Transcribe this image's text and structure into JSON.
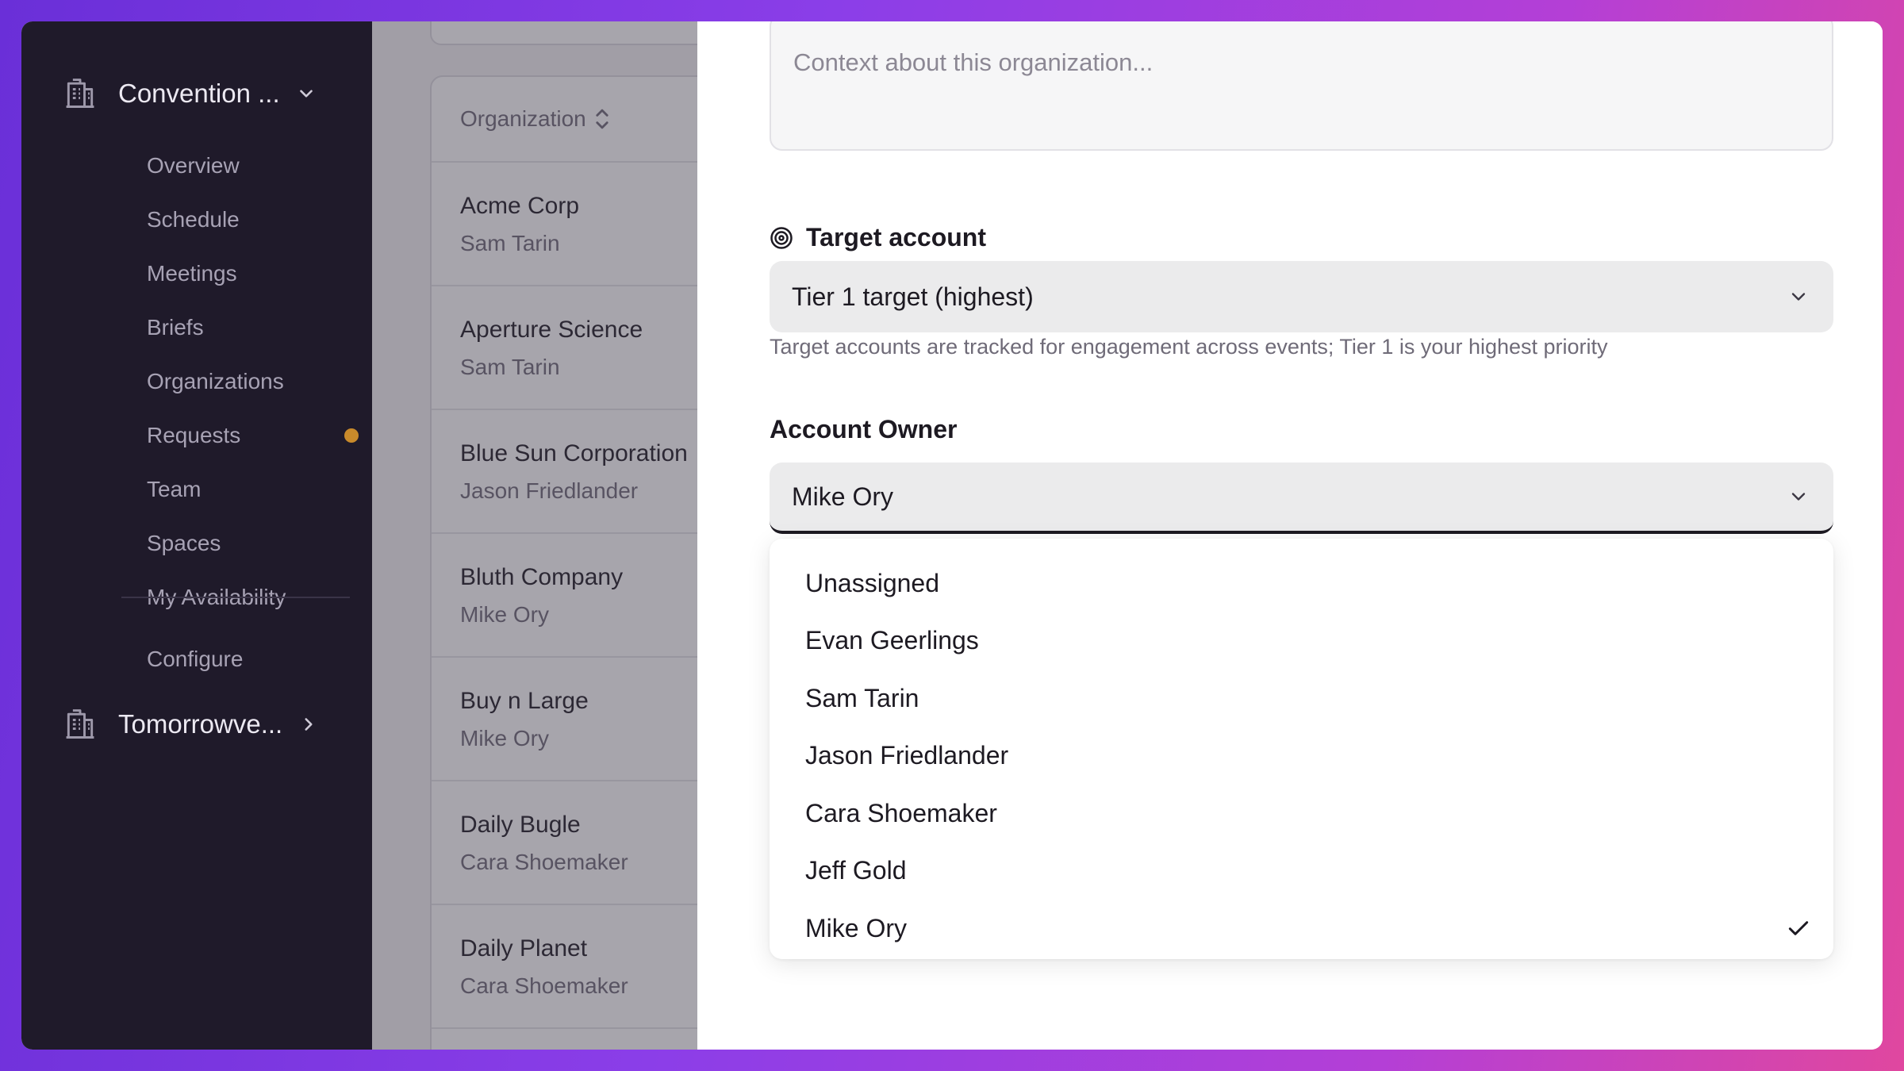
{
  "sidebar": {
    "org_primary": "Convention ...",
    "org_secondary": "Tomorrowve...",
    "nav": [
      {
        "label": "Overview"
      },
      {
        "label": "Schedule"
      },
      {
        "label": "Meetings"
      },
      {
        "label": "Briefs"
      },
      {
        "label": "Organizations"
      },
      {
        "label": "Requests",
        "badge": "dot"
      },
      {
        "label": "Team"
      },
      {
        "label": "Spaces"
      },
      {
        "label": "My Availability"
      }
    ],
    "configure": "Configure"
  },
  "list": {
    "header": "Organization",
    "rows": [
      {
        "name": "Acme Corp",
        "owner": "Sam Tarin"
      },
      {
        "name": "Aperture Science",
        "owner": "Sam Tarin"
      },
      {
        "name": "Blue Sun Corporation",
        "owner": "Jason Friedlander"
      },
      {
        "name": "Bluth Company",
        "owner": "Mike Ory"
      },
      {
        "name": "Buy n Large",
        "owner": "Mike Ory"
      },
      {
        "name": "Daily Bugle",
        "owner": "Cara Shoemaker"
      },
      {
        "name": "Daily Planet",
        "owner": "Cara Shoemaker"
      }
    ]
  },
  "panel": {
    "context_placeholder": "Context about this organization...",
    "target_label": "Target account",
    "target_value": "Tier 1 target (highest)",
    "target_help": "Target accounts are tracked for engagement across events; Tier 1 is your highest priority",
    "owner_label": "Account Owner",
    "owner_value": "Mike Ory",
    "owner_options": [
      "Unassigned",
      "Evan Geerlings",
      "Sam Tarin",
      "Jason Friedlander",
      "Cara Shoemaker",
      "Jeff Gold",
      "Mike Ory"
    ],
    "owner_selected": "Mike Ory"
  }
}
